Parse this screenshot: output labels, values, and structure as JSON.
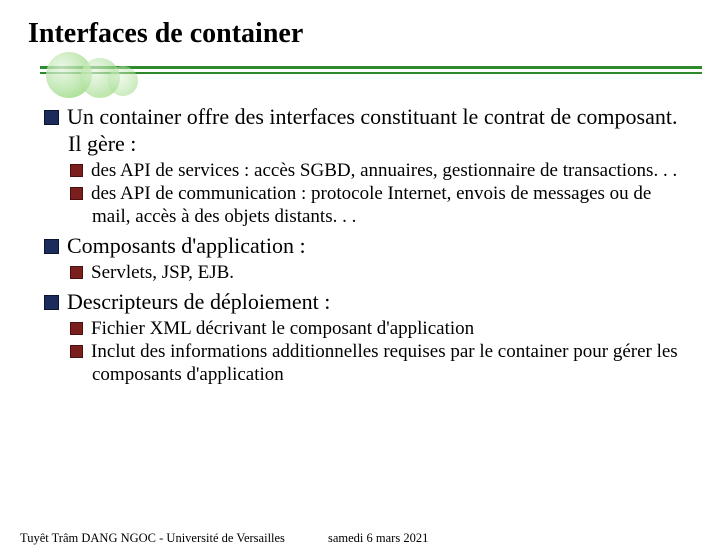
{
  "title": "Interfaces de container",
  "bullets": {
    "b1": "Un container offre des interfaces constituant le contrat de composant. Il gère :",
    "b1_1": "des API de services : accès SGBD, annuaires, gestionnaire de transactions. . .",
    "b1_2": "des API de communication : protocole Internet, envois de messages ou de mail, accès à des objets distants. . .",
    "b2": "Composants d'application :",
    "b2_1": "Servlets, JSP, EJB.",
    "b3": "Descripteurs de déploiement :",
    "b3_1": "Fichier XML décrivant le composant d'application",
    "b3_2": "Inclut des informations additionnelles requises par le container pour gérer les composants d'application"
  },
  "footer": {
    "author": "Tuyêt Trâm DANG NGOC - Université de Versailles",
    "date": "samedi 6 mars 2021"
  }
}
